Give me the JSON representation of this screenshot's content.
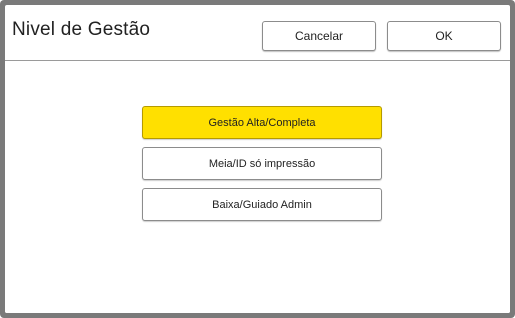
{
  "dialog": {
    "title": "Nivel de Gestão",
    "cancel_label": "Cancelar",
    "ok_label": "OK"
  },
  "options": [
    {
      "label": "Gestão Alta/Completa",
      "selected": true
    },
    {
      "label": "Meia/ID só impressão",
      "selected": false
    },
    {
      "label": "Baixa/Guiado Admin",
      "selected": false
    }
  ],
  "colors": {
    "selected_fill": "#ffe000",
    "frame": "#7a7a7a"
  }
}
